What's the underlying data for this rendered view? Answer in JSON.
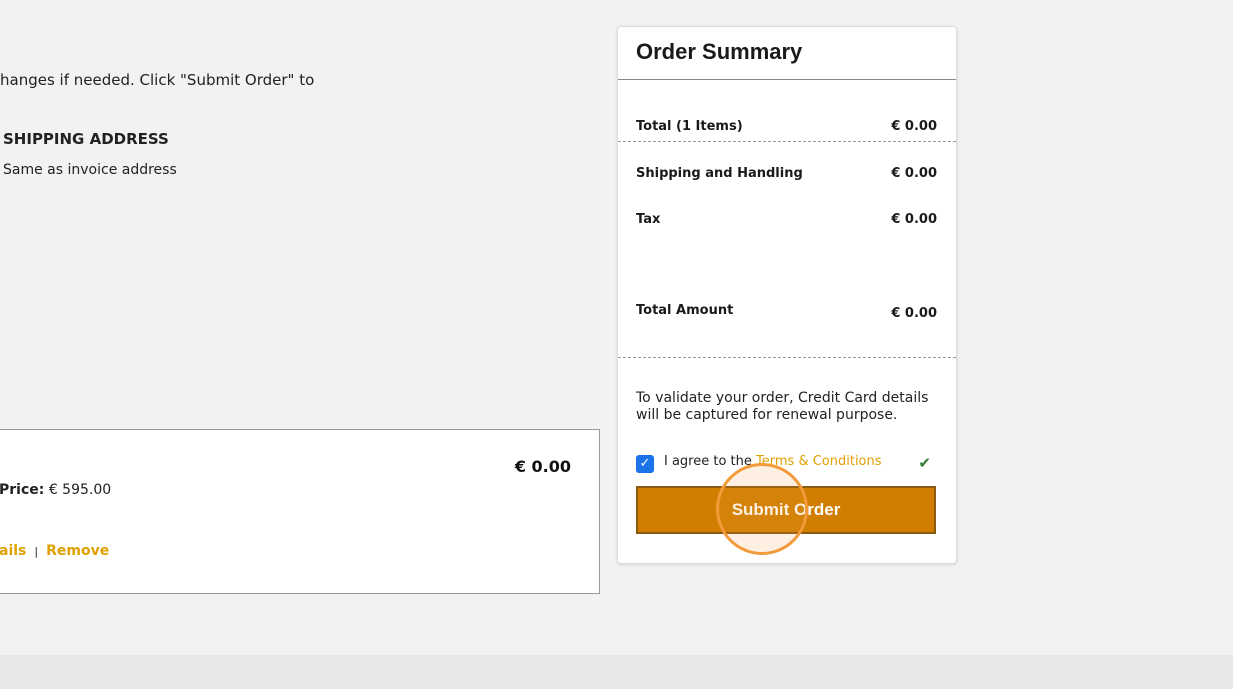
{
  "intro": {
    "text": "hanges if needed. Click \"Submit Order\" to"
  },
  "shipping": {
    "heading": "SHIPPING ADDRESS",
    "value": "Same as invoice address"
  },
  "cart_item": {
    "price": "€ 0.00",
    "unit_price_label": "Price:",
    "unit_price_value": "€ 595.00",
    "details_link": "ails",
    "separator": "|",
    "remove_link": "Remove"
  },
  "summary": {
    "title": "Order Summary",
    "rows": [
      {
        "label": "Total (1 Items)",
        "value": "€ 0.00"
      },
      {
        "label": "Shipping and Handling",
        "value": "€ 0.00"
      },
      {
        "label": "Tax",
        "value": "€ 0.00"
      },
      {
        "label": "Total Amount",
        "value": "€ 0.00"
      }
    ],
    "note": "To validate your order, Credit Card details will be captured for renewal purpose.",
    "agree_prefix": "I agree to the ",
    "terms_link": "Terms & Conditions",
    "submit_label": "Submit Order"
  },
  "icons": {
    "checkbox": "checkbox-checked-icon",
    "validation": "checkmark-icon"
  },
  "colors": {
    "accent": "#d17e00",
    "link": "#e0a000",
    "checkbox": "#1a73e8",
    "valid": "#2e7d32"
  }
}
